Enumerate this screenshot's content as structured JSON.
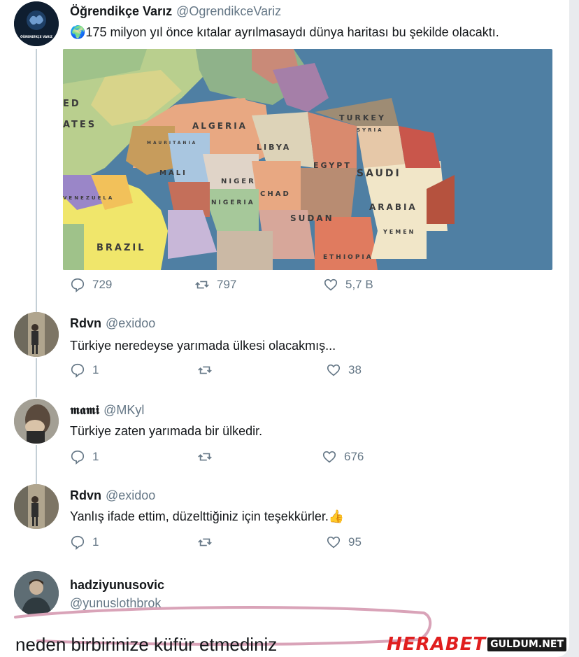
{
  "tweets": [
    {
      "name": "Öğrendikçe Varız",
      "handle": "@OgrendikceVariz",
      "text": "175 milyon yıl önce kıtalar ayrılmasaydı dünya haritası bu şekilde olacaktı.",
      "replies": "729",
      "retweets": "797",
      "likes": "5,7 B",
      "avatar_caption": "ÖĞRENDİKÇE VARIZ"
    },
    {
      "name": "Rdvn",
      "handle": "@exidoo",
      "text": "Türkiye neredeyse yarımada ülkesi olacakmış...",
      "replies": "1",
      "retweets": "",
      "likes": "38"
    },
    {
      "name": "𝖒𝖆𝖒𝖎",
      "handle": "@MKyl",
      "text": "Türkiye zaten yarımada bir ülkedir.",
      "replies": "1",
      "retweets": "",
      "likes": "676"
    },
    {
      "name": "Rdvn",
      "handle": "@exidoo",
      "text": "Yanlış ifade ettim, düzelttiğiniz için teşekkürler.",
      "replies": "1",
      "retweets": "",
      "likes": "95"
    },
    {
      "name": "hadziyunusovic",
      "handle": "@yunuslothbrok",
      "text": "neden birbirinize küfür etmediniz"
    }
  ],
  "map_labels": {
    "ates": "ATES",
    "ed": "ED",
    "algeria": "ALGERIA",
    "libya": "LIBYA",
    "egypt": "EGYPT",
    "turkey": "TURKEY",
    "syria": "SYRIA",
    "saudi": "SAUDI",
    "arabia": "ARABIA",
    "mali": "MALI",
    "niger": "NIGER",
    "chad": "CHAD",
    "sudan": "SUDAN",
    "nigeria": "NIGERIA",
    "yemen": "YEMEN",
    "ethiopia": "ETHIOPIA",
    "venezuela": "VENEZUELA",
    "brazil": "BRAZIL",
    "mauritania": "MAURITANIA"
  },
  "watermark": {
    "brand": "HERABET",
    "site": "GULDUM.NET"
  },
  "colors": {
    "text": "#14171a",
    "secondary": "#657786",
    "ocean": "#4f7fa3",
    "highlight": "#d9a3b8",
    "watermark_red": "#e01e1e"
  }
}
